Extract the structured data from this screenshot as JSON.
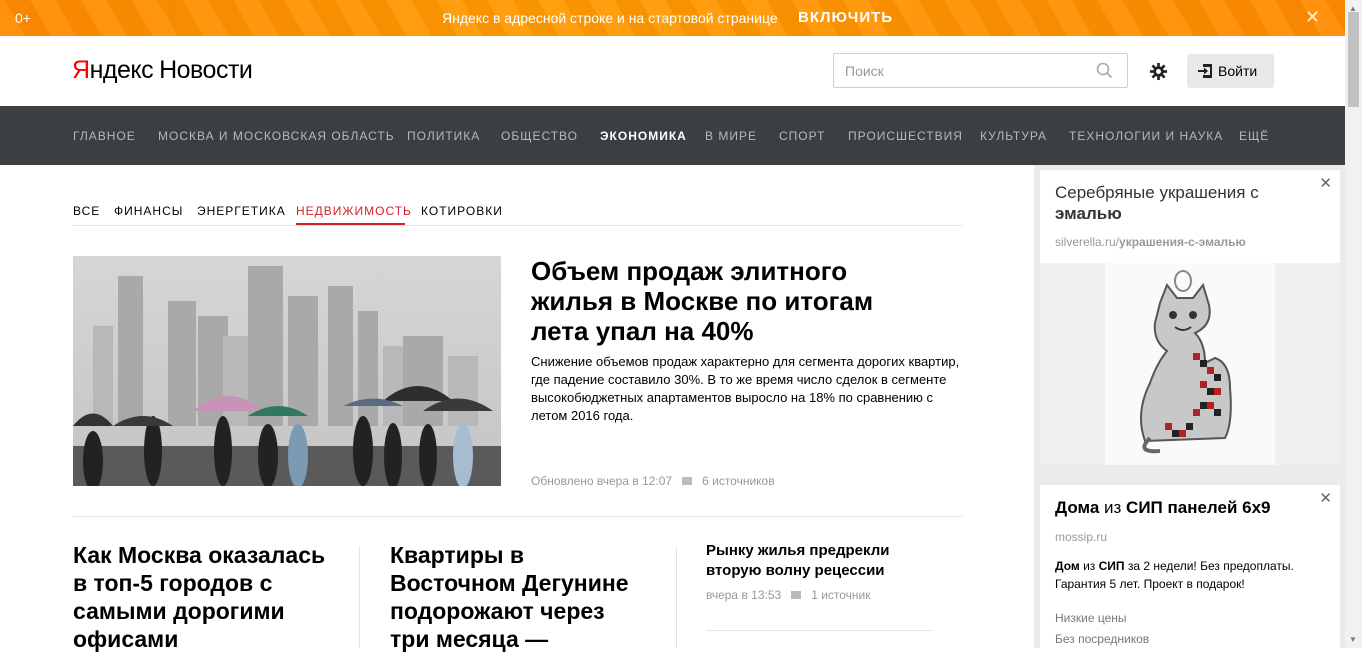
{
  "promo": {
    "age": "0+",
    "message": "Яндекс в адресной строке и на стартовой странице",
    "enable": "ВКЛЮЧИТЬ",
    "close": "✕"
  },
  "header": {
    "logo_y": "Я",
    "logo_rest": "ндекс",
    "logo_news": "Новости",
    "search_placeholder": "Поиск",
    "login": "Войти"
  },
  "nav": [
    "ГЛАВНОЕ",
    "МОСКВА И МОСКОВСКАЯ ОБЛАСТЬ",
    "ПОЛИТИКА",
    "ОБЩЕСТВО",
    "ЭКОНОМИКА",
    "В МИРЕ",
    "СПОРТ",
    "ПРОИСШЕСТВИЯ",
    "КУЛЬТУРА",
    "ТЕХНОЛОГИИ И НАУКА",
    "ЕЩЁ"
  ],
  "subnav": [
    "ВСЕ",
    "ФИНАНСЫ",
    "ЭНЕРГЕТИКА",
    "НЕДВИЖИМОСТЬ",
    "КОТИРОВКИ"
  ],
  "main_story": {
    "title": "Объем продаж элитного жилья в Москве по итогам лета упал на 40%",
    "text": "Снижение объемов продаж характерно для сегмента дорогих квартир, где падение составило 30%. В то же время число сделок в сегменте высокобюджетных апартаментов выросло на 18% по сравнению с летом 2016 года.",
    "updated": "Обновлено вчера в 12:07",
    "sources": "6 источников"
  },
  "stories": {
    "s1": "Как Москва оказалась в топ-5 городов с самыми дорогими офисами",
    "s2": "Квартиры в Восточном Дегунине подорожают через три месяца —",
    "s3": "Рынку жилья предрекли вторую волну рецессии",
    "s3_time": "вчера в 13:53",
    "s3_sources": "1 источник"
  },
  "ad1": {
    "title_plain": "Серебряные украшения с ",
    "title_bold": "эмалью",
    "domain_plain": "silverella.ru/",
    "domain_bold": "украшения-с-эмалью",
    "close": "✕"
  },
  "ad2": {
    "title_bold1": "Дома",
    "title_plain": " из ",
    "title_bold2": "СИП панелей 6х9",
    "domain": "mossip.ru",
    "text_b1": "Дом",
    "text_p1": " из ",
    "text_b2": "СИП",
    "text_p2": " за 2 недели! Без предоплаты. Гарантия 5 лет. Проект в подарок!",
    "link1": "Низкие цены",
    "link2": "Без посредников",
    "close": "✕"
  }
}
